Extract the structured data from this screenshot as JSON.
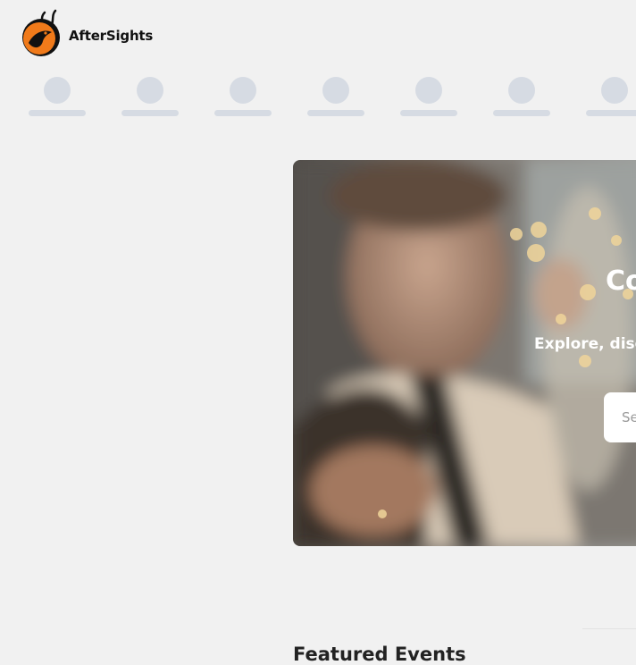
{
  "header": {
    "brand_name": "AfterSights",
    "logo_icon": "gazelle-logo-icon"
  },
  "category_skeletons": [
    {},
    {},
    {},
    {},
    {},
    {},
    {}
  ],
  "hero": {
    "title": "Co",
    "subtitle": "Explore, discov",
    "search_placeholder": "Se"
  },
  "featured": {
    "title": "Featured Events"
  },
  "colors": {
    "accent": "#f07a1a",
    "skeleton": "#d6dbe3",
    "background": "#f1f1f1"
  }
}
